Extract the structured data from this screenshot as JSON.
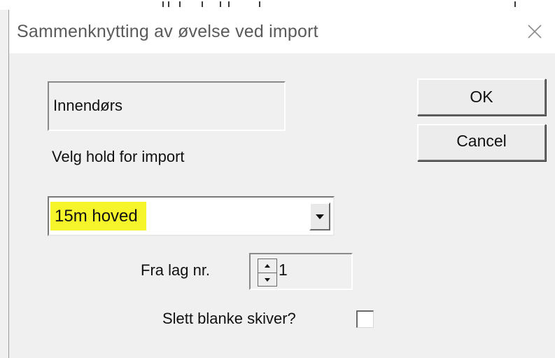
{
  "dialog": {
    "title": "Sammenknytting av øvelse ved import",
    "close_icon": "close-icon"
  },
  "event_name": "Innendørs",
  "team_select": {
    "label": "Velg hold for import",
    "selected": "15m hoved",
    "dropdown_icon": "chevron-down-icon",
    "highlight_color": "#f6f52c"
  },
  "lane": {
    "label": "Fra lag nr.",
    "value": "1",
    "up_icon": "spin-up-icon",
    "down_icon": "spin-down-icon"
  },
  "delete_blank": {
    "label": "Slett blanke skiver?",
    "checked": false
  },
  "buttons": {
    "ok": "OK",
    "cancel": "Cancel"
  }
}
